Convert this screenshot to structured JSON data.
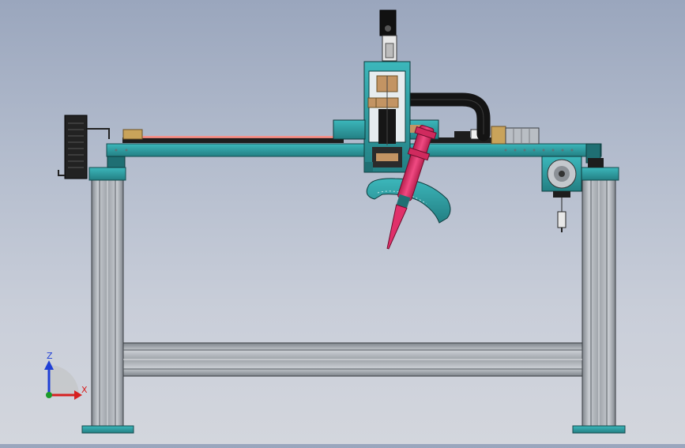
{
  "viewport": {
    "background_top": "#9aa6bd",
    "background_bottom": "#d3d6dd"
  },
  "colors": {
    "teal": "#2f9ea3",
    "teal_dark": "#1f6f73",
    "aluminum": "#a9adb3",
    "aluminum_dark": "#6e7379",
    "black": "#1a1a1a",
    "copper": "#b98a5a",
    "syringe": "#e0306a",
    "syringe_dark": "#a01e4a",
    "rail_glow": "#ff8a80"
  },
  "model": {
    "components": [
      "left-leg",
      "right-leg",
      "lower-crossbeam",
      "top-gantry-beam",
      "z-axis-carriage",
      "x-axis-motor",
      "cooling-fan",
      "dispensing-syringe",
      "cable-chain",
      "side-stepper-motor"
    ]
  },
  "triad": {
    "z_label": "Z",
    "x_label": "X",
    "z_color": "#1f3fd6",
    "x_color": "#d62020",
    "y_color": "#1a9a2a"
  }
}
